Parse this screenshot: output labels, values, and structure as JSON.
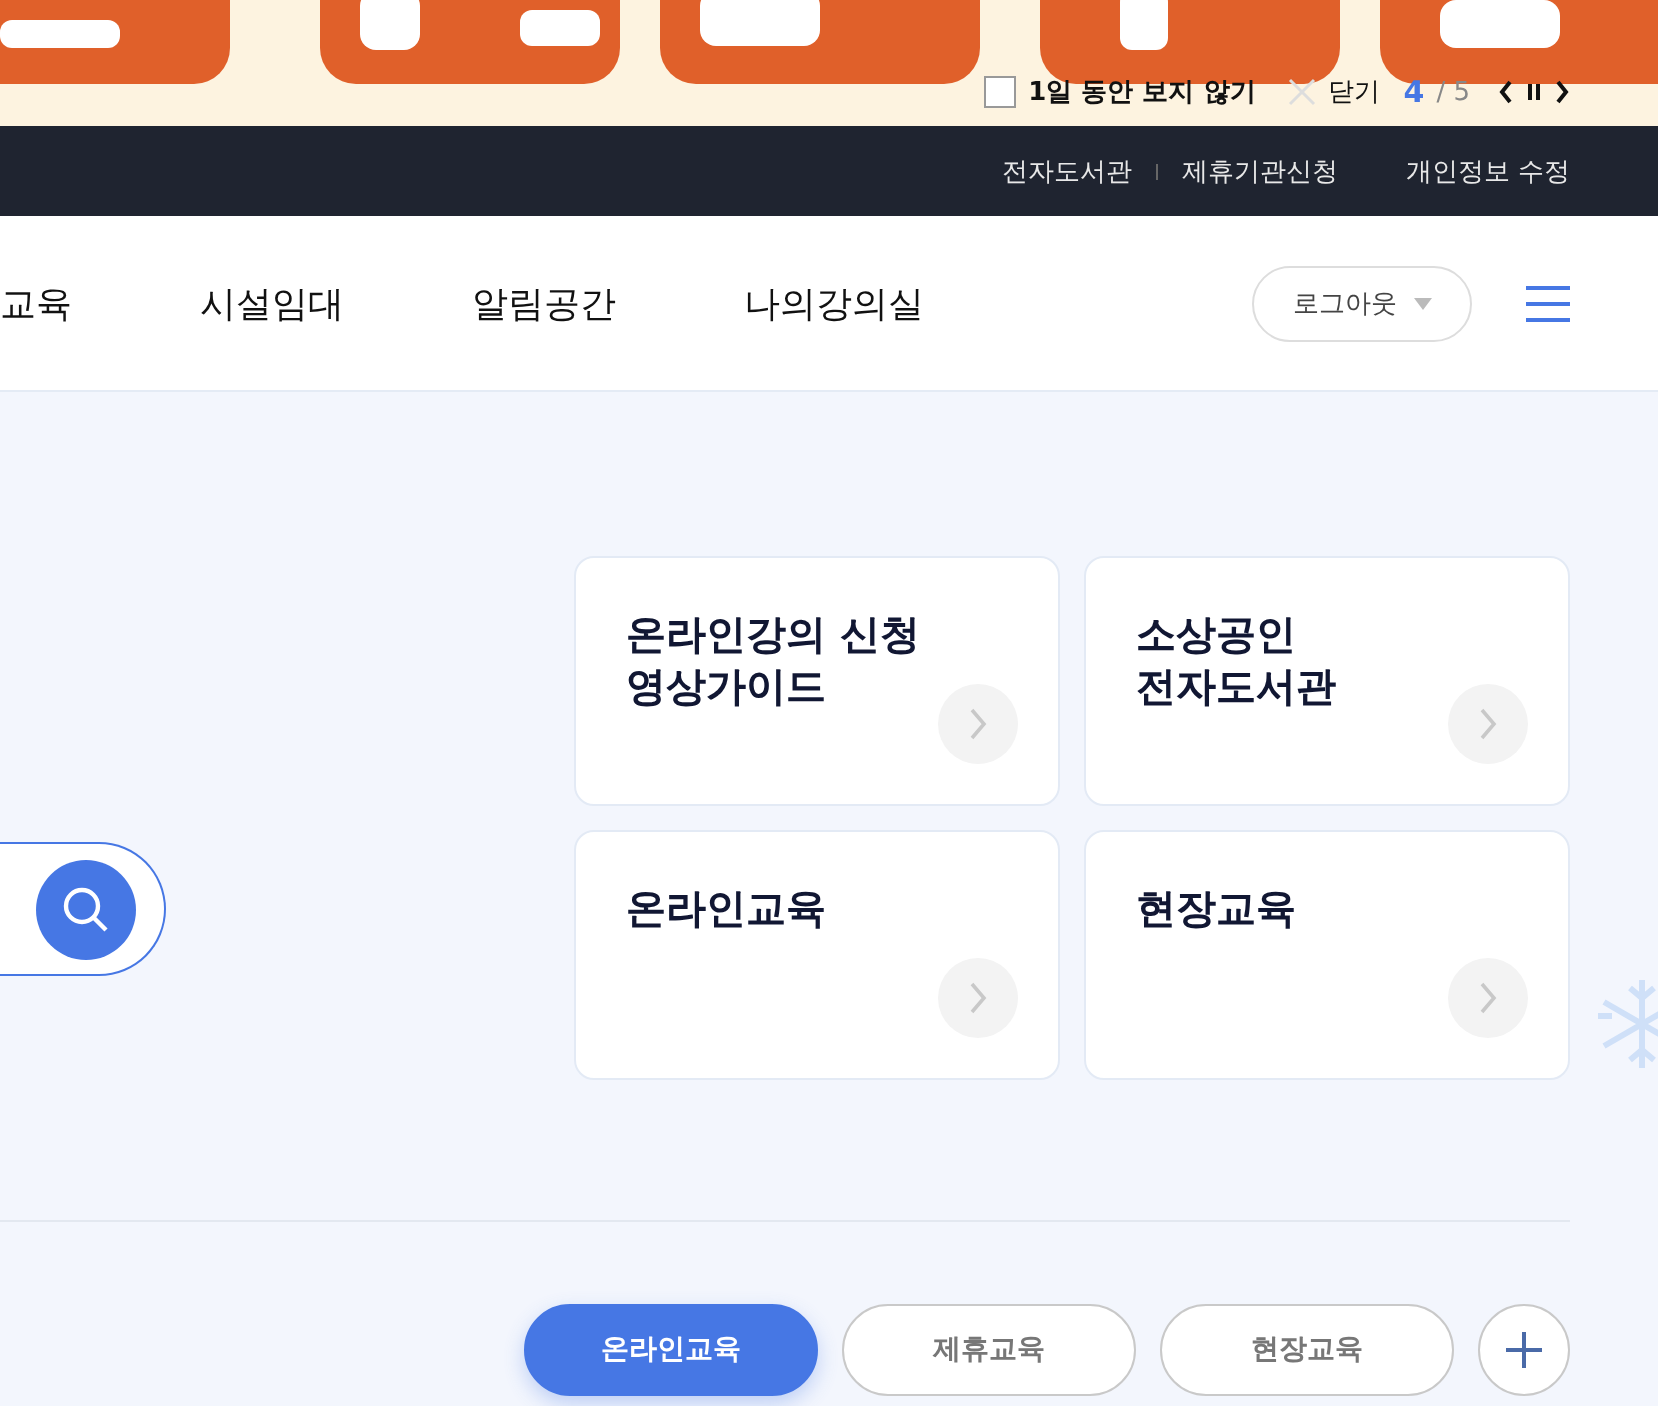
{
  "banner": {
    "dismiss": {
      "label": "1일 동안 보지 않기",
      "checked": false
    },
    "close_label": "닫기",
    "page_current": "4",
    "page_total": "/ 5"
  },
  "utility_links": [
    "전자도서관",
    "제휴기관신청",
    "개인정보 수정"
  ],
  "nav": {
    "items": [
      "교육",
      "시설임대",
      "알림공간",
      "나의강의실"
    ],
    "logout": "로그아웃"
  },
  "cards": [
    {
      "title": "온라인강의 신청\n영상가이드"
    },
    {
      "title": "소상공인\n전자도서관"
    },
    {
      "title": "온라인교육"
    },
    {
      "title": "현장교육"
    }
  ],
  "tabs": [
    {
      "label": "온라인교육",
      "selected": true
    },
    {
      "label": "제휴교육",
      "selected": false
    },
    {
      "label": "현장교육",
      "selected": false
    }
  ]
}
